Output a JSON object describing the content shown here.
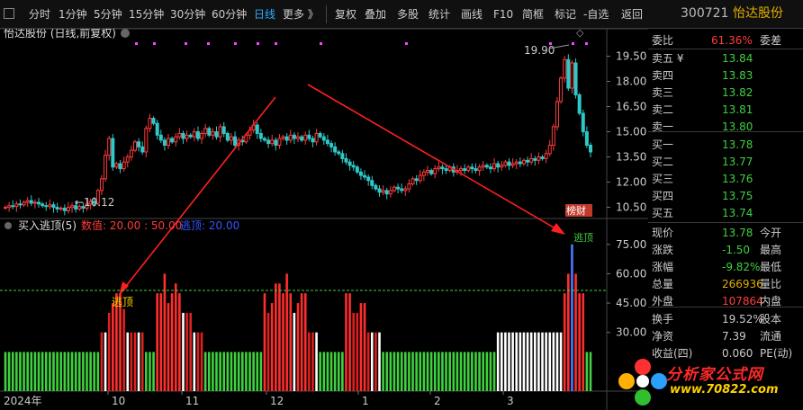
{
  "toolbar": {
    "periods": [
      "分时",
      "1分钟",
      "5分钟",
      "15分钟",
      "30分钟",
      "60分钟",
      "日线",
      "更多 》"
    ],
    "active_period": "日线",
    "actions": [
      "复权",
      "叠加",
      "多股",
      "统计",
      "画线",
      "F10",
      "简框",
      "标记"
    ],
    "check_label": "自选",
    "back_label": "返回",
    "stock_code": "300721",
    "stock_name": "怡达股份"
  },
  "main_panel": {
    "title": "怡达股份 (日线,前复权)"
  },
  "indicator_panel": {
    "title": "买入逃顶(5)",
    "value_label": "数值: 20.00 : 50.00",
    "escape_label": "逃顶: 20.00",
    "sell_signal_text": "逃顶",
    "badge": "榜财"
  },
  "quote": {
    "ratio_label": "委比",
    "ratio_value": "61.36%",
    "diff_label": "委差",
    "asks": [
      {
        "label": "卖五 ¥",
        "price": "13.84"
      },
      {
        "label": "卖四",
        "price": "13.83"
      },
      {
        "label": "卖三",
        "price": "13.82"
      },
      {
        "label": "卖二",
        "price": "13.81"
      },
      {
        "label": "卖一",
        "price": "13.80"
      }
    ],
    "bids": [
      {
        "label": "买一",
        "price": "13.78"
      },
      {
        "label": "买二",
        "price": "13.77"
      },
      {
        "label": "买三",
        "price": "13.76"
      },
      {
        "label": "买四",
        "price": "13.75"
      },
      {
        "label": "买五",
        "price": "13.74"
      }
    ],
    "stats": [
      {
        "l1": "现价",
        "v1": "13.78",
        "l2": "今开"
      },
      {
        "l1": "涨跌",
        "v1": "-1.50",
        "l2": "最高"
      },
      {
        "l1": "涨幅",
        "v1": "-9.82%",
        "l2": "最低"
      },
      {
        "l1": "总量",
        "v1": "266936",
        "l2": "量比"
      },
      {
        "l1": "外盘",
        "v1": "107864",
        "l2": "内盘"
      },
      {
        "l1": "换手",
        "v1": "19.52%",
        "l2": "股本"
      },
      {
        "l1": "净资",
        "v1": "7.39",
        "l2": "流通"
      },
      {
        "l1": "收益(四)",
        "v1": "0.060",
        "l2": "PE(动)"
      }
    ]
  },
  "watermark": {
    "title": "分析家公式网",
    "url": "www.70822.com"
  },
  "colors": {
    "up": "#ff3b3b",
    "down": "#2ec8c8",
    "green": "#3fd13f",
    "gold": "#e0b000",
    "accent": "#ff3030",
    "magenta": "#ff40ff"
  },
  "chart_data": [
    {
      "type": "candlestick",
      "title": "怡达股份 (日线,前复权)",
      "y_ticks": [
        10.5,
        12.0,
        13.5,
        15.0,
        16.5,
        18.0,
        19.5
      ],
      "ylim": [
        9.3,
        20.6
      ],
      "x_ticks": [
        "2024年",
        "10",
        "11",
        "12",
        "1",
        "2",
        "3"
      ],
      "annotations": [
        "19.90",
        "10.12"
      ],
      "close_series": [
        10.5,
        10.6,
        10.55,
        10.7,
        10.65,
        10.8,
        10.9,
        10.75,
        10.8,
        10.7,
        10.6,
        10.55,
        10.65,
        10.5,
        10.4,
        10.45,
        10.3,
        10.5,
        10.6,
        10.4,
        10.55,
        10.45,
        10.7,
        10.85,
        10.75,
        11.5,
        12.2,
        13.6,
        14.6,
        12.9,
        13.1,
        12.8,
        13.2,
        13.5,
        13.9,
        14.4,
        14.1,
        13.8,
        15.2,
        15.8,
        15.5,
        14.8,
        14.5,
        14.2,
        14.6,
        14.4,
        14.7,
        14.9,
        14.6,
        14.8,
        14.7,
        15.0,
        14.6,
        14.9,
        15.2,
        14.8,
        15.0,
        14.7,
        15.3,
        14.9,
        14.5,
        14.7,
        14.2,
        14.5,
        14.4,
        14.8,
        15.1,
        15.4,
        14.9,
        14.6,
        14.5,
        14.3,
        14.5,
        14.2,
        14.6,
        14.7,
        14.5,
        14.8,
        14.6,
        14.7,
        14.5,
        14.8,
        14.6,
        14.4,
        14.9,
        14.7,
        14.5,
        14.3,
        14.1,
        13.8,
        13.7,
        13.4,
        13.2,
        13.0,
        12.9,
        12.6,
        12.4,
        12.3,
        12.1,
        11.8,
        11.6,
        11.4,
        11.5,
        11.3,
        11.5,
        11.7,
        11.6,
        11.5,
        11.6,
        11.9,
        12.2,
        12.1,
        12.4,
        12.6,
        12.7,
        12.5,
        12.8,
        12.9,
        12.8,
        12.7,
        12.9,
        12.6,
        12.7,
        12.8,
        12.7,
        12.9,
        12.8,
        12.7,
        12.9,
        13.0,
        12.9,
        12.8,
        13.1,
        12.9,
        13.0,
        13.2,
        13.0,
        13.1,
        13.2,
        13.1,
        13.3,
        13.2,
        13.4,
        13.3,
        13.5,
        13.4,
        13.7,
        14.2,
        15.3,
        16.8,
        18.2,
        19.3,
        17.6,
        19.1,
        17.2,
        16.1,
        15.0,
        14.2,
        13.8
      ]
    },
    {
      "type": "bar",
      "title": "买入逃顶(5)",
      "y_ticks": [
        30.0,
        45.0,
        60.0,
        75.0
      ],
      "ylim": [
        0,
        85
      ],
      "reference_line": 50,
      "series": [
        {
          "name": "数值",
          "values": [
            20,
            20,
            20,
            20,
            20,
            20,
            20,
            20,
            20,
            20,
            20,
            20,
            20,
            20,
            20,
            20,
            20,
            20,
            20,
            20,
            20,
            20,
            20,
            20,
            20,
            20,
            30,
            30,
            40,
            45,
            50,
            50,
            42,
            30,
            30,
            30,
            30,
            30,
            20,
            20,
            20,
            50,
            50,
            60,
            45,
            50,
            55,
            50,
            40,
            40,
            40,
            30,
            30,
            30,
            20,
            20,
            20,
            20,
            20,
            20,
            20,
            20,
            20,
            20,
            20,
            20,
            20,
            20,
            20,
            20,
            50,
            40,
            45,
            55,
            55,
            50,
            60,
            50,
            40,
            45,
            50,
            50,
            30,
            30,
            30,
            20,
            20,
            20,
            20,
            20,
            20,
            20,
            50,
            50,
            40,
            40,
            45,
            45,
            30,
            30,
            30,
            30,
            20,
            20,
            20,
            20,
            20,
            20,
            20,
            20,
            20,
            20,
            20,
            20,
            20,
            20,
            20,
            20,
            20,
            20,
            20,
            20,
            20,
            20,
            20,
            20,
            20,
            20,
            20,
            20,
            20,
            20,
            20,
            30,
            30,
            30,
            30,
            30,
            30,
            30,
            30,
            30,
            30,
            30,
            30,
            30,
            30,
            30,
            30,
            30,
            30,
            50,
            60,
            75,
            60,
            50,
            50,
            20,
            20
          ]
        }
      ]
    }
  ]
}
